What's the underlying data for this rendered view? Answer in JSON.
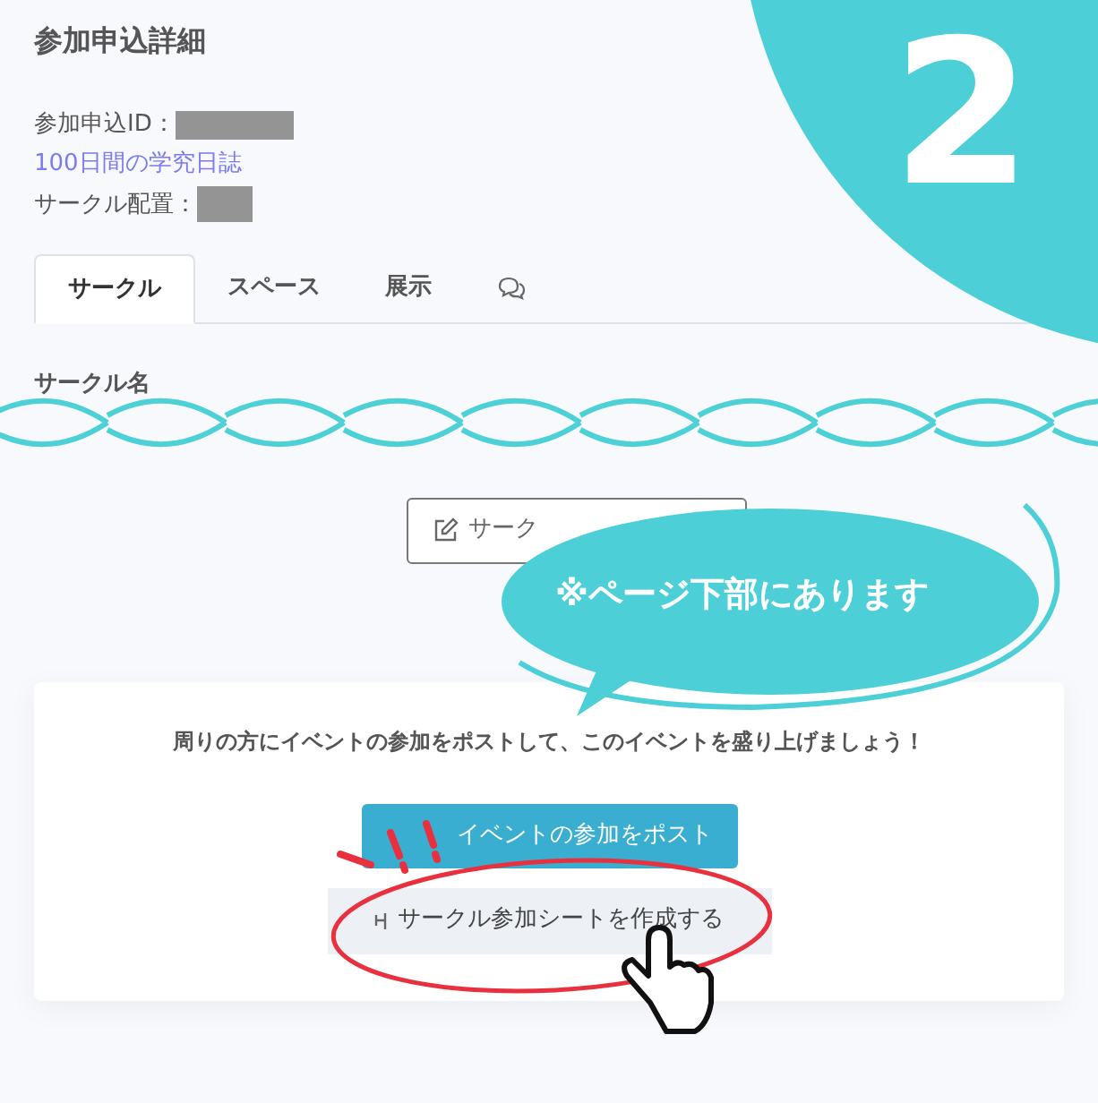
{
  "page": {
    "title": "参加申込詳細"
  },
  "info": [
    {
      "kind": "redacted",
      "label": "参加申込ID："
    },
    {
      "kind": "link",
      "label": "100日間の学究日誌"
    },
    {
      "kind": "redacted",
      "label": "サークル配置："
    }
  ],
  "tabs": [
    {
      "label": "サークル",
      "kind": "text",
      "selected": true
    },
    {
      "label": "スペース",
      "kind": "text",
      "selected": false
    },
    {
      "label": "展示",
      "kind": "text",
      "selected": false
    },
    {
      "kind": "chat-icon",
      "selected": false
    }
  ],
  "section": {
    "label": "サークル名"
  },
  "edit_button": {
    "label": "サーク"
  },
  "card": {
    "message": "周りの方にイベントの参加をポストして、このイベントを盛り上げましょう！",
    "post_button": "イベントの参加をポスト",
    "sheet_button": "サークル参加シートを作成する"
  },
  "overlay": {
    "step": "2",
    "callout": "※ページ下部にあります"
  }
}
